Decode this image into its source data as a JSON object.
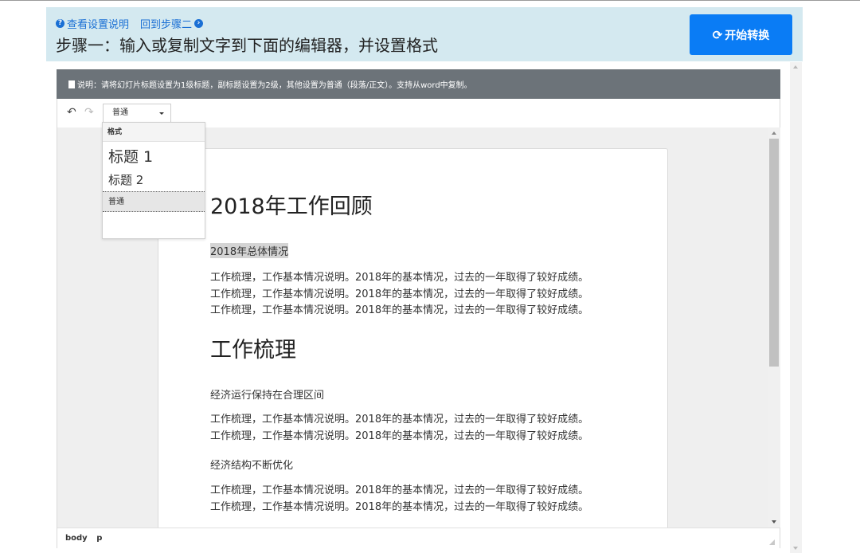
{
  "header": {
    "help_link": "查看设置说明",
    "back_link": "回到步骤二",
    "title": "步骤一：输入或复制文字到下面的编辑器，并设置格式",
    "convert_button": "开始转换"
  },
  "notice": "说明：请将幻灯片标题设置为1级标题，副标题设置为2级，其他设置为普通（段落/正文）。支持从word中复制。",
  "toolbar": {
    "format_value": "普通"
  },
  "dropdown": {
    "header": "格式",
    "items": [
      "标题 1",
      "标题 2",
      "普通"
    ],
    "selected": "普通"
  },
  "document": {
    "title": "2018年工作回顾",
    "sub1": "2018年总体情况",
    "para1": [
      "工作梳理，工作基本情况说明。2018年的基本情况，过去的一年取得了较好成绩。",
      "工作梳理，工作基本情况说明。2018年的基本情况，过去的一年取得了较好成绩。",
      "工作梳理，工作基本情况说明。2018年的基本情况，过去的一年取得了较好成绩。"
    ],
    "heading2": "工作梳理",
    "sub2": "经济运行保持在合理区间",
    "para2": [
      "工作梳理，工作基本情况说明。2018年的基本情况，过去的一年取得了较好成绩。",
      "工作梳理，工作基本情况说明。2018年的基本情况，过去的一年取得了较好成绩。"
    ],
    "sub3": "经济结构不断优化",
    "para3": [
      "工作梳理，工作基本情况说明。2018年的基本情况，过去的一年取得了较好成绩。",
      "工作梳理，工作基本情况说明。2018年的基本情况，过去的一年取得了较好成绩。"
    ]
  },
  "statusbar": {
    "path": [
      "body",
      "p"
    ]
  },
  "colors": {
    "header_bg": "#d4e9f0",
    "link": "#1a6fd4",
    "primary_button": "#0a7cf5",
    "notice_bg": "#6c7379"
  },
  "icons": {
    "help": "question-circle-icon",
    "back": "arrow-circle-right-icon",
    "convert": "refresh-icon",
    "undo": "undo-icon",
    "redo": "redo-icon",
    "notice": "document-icon"
  }
}
